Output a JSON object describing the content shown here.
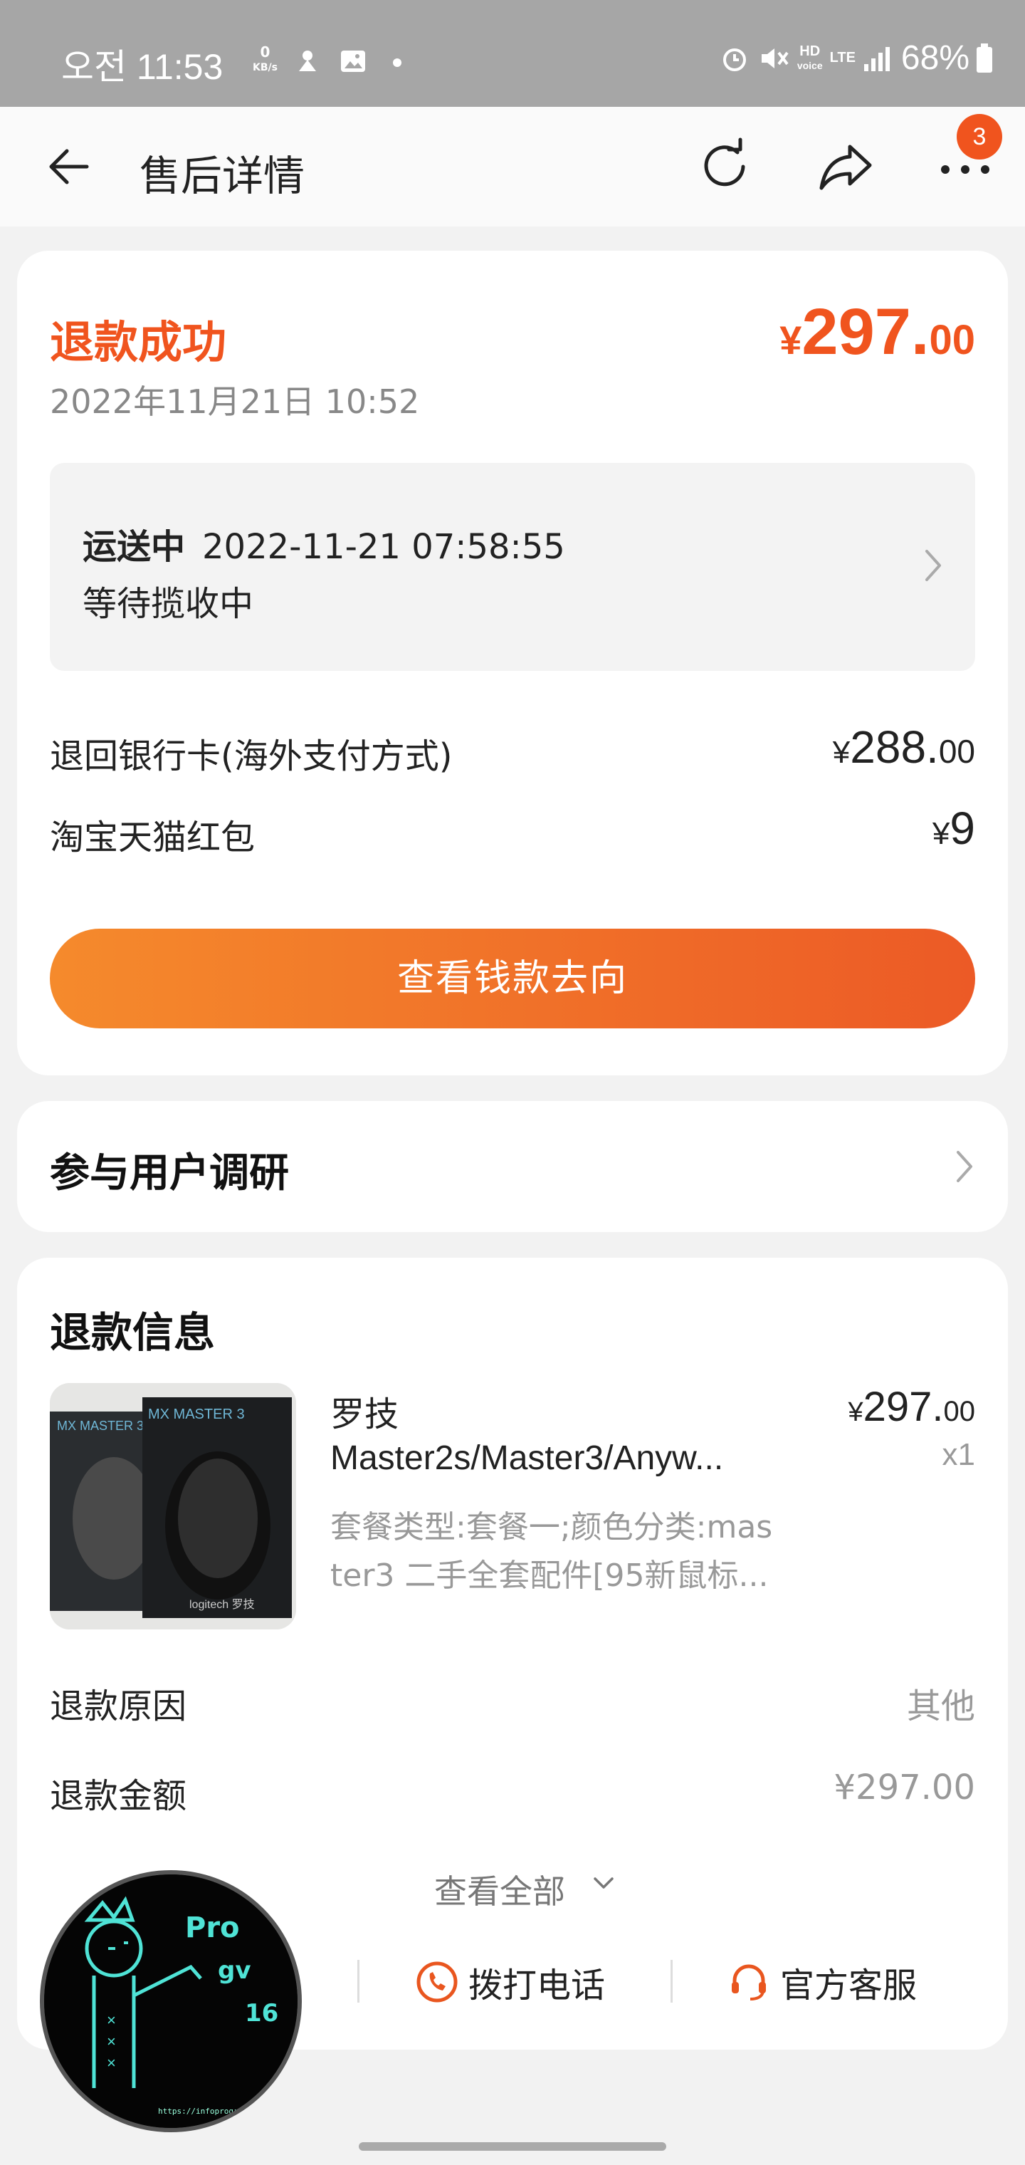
{
  "status_bar": {
    "time": "오전 11:53",
    "net_speed": "0",
    "net_unit": "KB/s",
    "hd": "HD",
    "voice": "voice",
    "lte": "LTE",
    "battery": "68%"
  },
  "header": {
    "title": "售后详情",
    "badge_count": "3"
  },
  "refund_status": {
    "title": "退款成功",
    "currency": "¥",
    "amount_int": "297.",
    "amount_dec": "00",
    "time": "2022年11月21日 10:52"
  },
  "shipping": {
    "status": "运送中",
    "time": "2022-11-21 07:58:55",
    "detail": "等待揽收中"
  },
  "breakdown": [
    {
      "label": "退回银行卡(海外支付方式)",
      "currency": "¥",
      "int": "288.",
      "dec": "00"
    },
    {
      "label": "淘宝天猫红包",
      "currency": "¥",
      "int": "9",
      "dec": ""
    }
  ],
  "cta_label": "查看钱款去向",
  "survey": {
    "title": "参与用户调研"
  },
  "refund_info": {
    "title": "退款信息",
    "product": {
      "name_line1": "罗技",
      "name_line2": "Master2s/Master3/Anyw...",
      "sku_line1": "套餐类型:套餐一;颜色分类:mas",
      "sku_line2": "ter3 二手全套配件[95新鼠标...",
      "currency": "¥",
      "price_int": "297.",
      "price_dec": "00",
      "qty": "x1",
      "image_text": "MX MASTER 3",
      "image_brand": "logitech 罗技"
    },
    "reason_label": "退款原因",
    "reason_value": "其他",
    "amount_label": "退款金额",
    "amount_value": "¥297.00",
    "see_all": "查看全部"
  },
  "actions": {
    "call": "拨打电话",
    "service": "官方客服"
  },
  "watermark": {
    "text1": "Pro",
    "text2": "gv",
    "text3": "16",
    "url": "https://infoprogramming.tistory.com"
  },
  "colors": {
    "accent": "#f0541e",
    "cta_start": "#f58a2c",
    "cta_end": "#ec5a26",
    "icon_orange": "#e9561f"
  }
}
